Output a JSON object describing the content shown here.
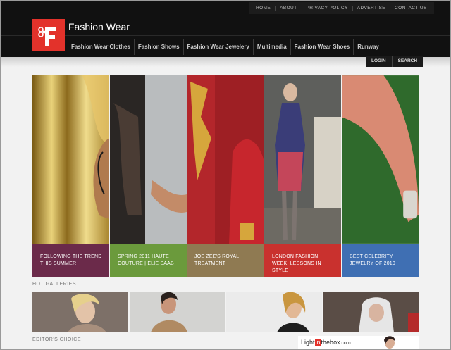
{
  "top_links": [
    "HOME",
    "ABOUT",
    "PRIVACY POLICY",
    "ADVERTISE",
    "CONTACT US"
  ],
  "site": {
    "title": "Fashion Wear"
  },
  "nav": [
    "Fashion Wear Clothes",
    "Fashion Shows",
    "Fashion Wear Jewelery",
    "Multimedia",
    "Fashion Wear Shoes",
    "Runway"
  ],
  "util": {
    "login": "LOGIN",
    "search": "SEARCH"
  },
  "slides": [
    {
      "caption": "Following the trend this summer",
      "color": "#6b2a4a"
    },
    {
      "caption": "Spring 2011 Haute Couture | Elie Saab",
      "color": "#6b9a3c"
    },
    {
      "caption": "Joe Zee's Royal Treatment",
      "color": "#8f7a52"
    },
    {
      "caption": "London Fashion Week: Lessons in Style",
      "color": "#c9312e"
    },
    {
      "caption": "Best Celebrity Jewelry of 2010",
      "color": "#3f6fb3"
    }
  ],
  "sections": {
    "hot_galleries": "HOT GALLERIES",
    "editors_choice": "EDITOR'S CHOICE"
  },
  "ad": {
    "brand_pre": "Light",
    "brand_in": "in",
    "brand_post": "thebox",
    "brand_com": ".com"
  }
}
